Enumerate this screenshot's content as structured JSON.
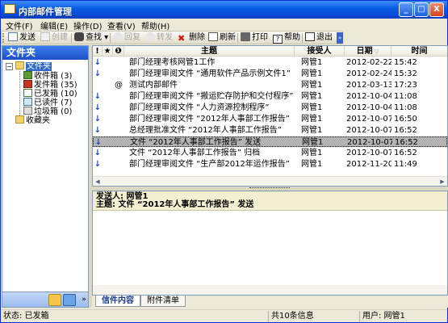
{
  "window": {
    "title": "内部邮件管理",
    "controls": [
      "_",
      "□",
      "X"
    ]
  },
  "menu": [
    {
      "label": "文件(F)"
    },
    {
      "label": "编辑(E)"
    },
    {
      "label": "操作(D)"
    },
    {
      "label": "查看(V)"
    },
    {
      "label": "帮助(H)"
    }
  ],
  "toolbar": {
    "send": "发送",
    "create": "创建",
    "find": "查找",
    "reply": "回复",
    "forward": "转发",
    "delete": "删除",
    "refresh": "刷新",
    "print": "打印",
    "help": "帮助",
    "exit": "退出"
  },
  "folders": {
    "title": "文件夹",
    "root": "文件夹",
    "items": [
      {
        "label": "收件箱 (3)"
      },
      {
        "label": "发件箱 (35)"
      },
      {
        "label": "已发箱 (10)"
      },
      {
        "label": "已读件 (7)"
      },
      {
        "label": "垃圾箱 (0)"
      }
    ],
    "favorites": "收藏夹"
  },
  "mail_list": {
    "columns": {
      "flag": "!",
      "star": "★",
      "attach": "❶",
      "subject": "主题",
      "receiver": "接受人",
      "date": "日期",
      "time": "时间"
    },
    "rows": [
      {
        "arrow": "↓",
        "attach": "",
        "subject": "部门经理考核网管1工作",
        "receiver": "网管1",
        "date": "2012-02-22",
        "time": "15:42"
      },
      {
        "arrow": "↓",
        "attach": "",
        "subject": "部门经理审阅文件 “通用软件产品示例文件1”",
        "receiver": "网管1",
        "date": "2012-02-24",
        "time": "15:32"
      },
      {
        "arrow": "",
        "attach": "@",
        "subject": "测试内部邮件",
        "receiver": "网管1",
        "date": "2012-03-13",
        "time": "17:23"
      },
      {
        "arrow": "↓",
        "attach": "",
        "subject": "部门经理审阅文件 “搬运贮存防护和交付程序”",
        "receiver": "网管1",
        "date": "2012-10-04",
        "time": "11:08"
      },
      {
        "arrow": "↓",
        "attach": "",
        "subject": "部门经理审阅文件 “人力资源控制程序”",
        "receiver": "网管1",
        "date": "2012-10-04",
        "time": "11:08"
      },
      {
        "arrow": "↓",
        "attach": "",
        "subject": "部门经理审阅文件 “2012年人事部工作报告”",
        "receiver": "网管1",
        "date": "2012-10-07",
        "time": "16:50"
      },
      {
        "arrow": "↓",
        "attach": "",
        "subject": "总经理批准文件 “2012年人事部工作报告”",
        "receiver": "网管1",
        "date": "2012-10-07",
        "time": "16:52"
      },
      {
        "arrow": "↓",
        "attach": "",
        "subject": "文件 “2012年人事部工作报告” 发送",
        "receiver": "网管1",
        "date": "2012-10-07",
        "time": "16:52"
      },
      {
        "arrow": "↓",
        "attach": "",
        "subject": "文件 “2012年人事部工作报告” 归档",
        "receiver": "网管1",
        "date": "2012-10-07",
        "time": "16:52"
      },
      {
        "arrow": "↓",
        "attach": "",
        "subject": "部门经理审阅文件 “生产部2012年运作报告”",
        "receiver": "网管1",
        "date": "2012-11-20",
        "time": "11:49"
      }
    ],
    "selected_index": 7
  },
  "preview": {
    "sender": "发送人: 网管1",
    "subject": "主题: 文件 “2012年人事部工作报告” 发送"
  },
  "tabs": [
    {
      "label": "信件内容"
    },
    {
      "label": "附件清单"
    }
  ],
  "status": {
    "state": "状态: 已发箱",
    "count": "共10条信息",
    "user": "用户: 网管1"
  },
  "colors": {
    "titlebar": "#0a5fe6",
    "selection": "#316ac5",
    "accent_blue": "#1b47b3"
  }
}
